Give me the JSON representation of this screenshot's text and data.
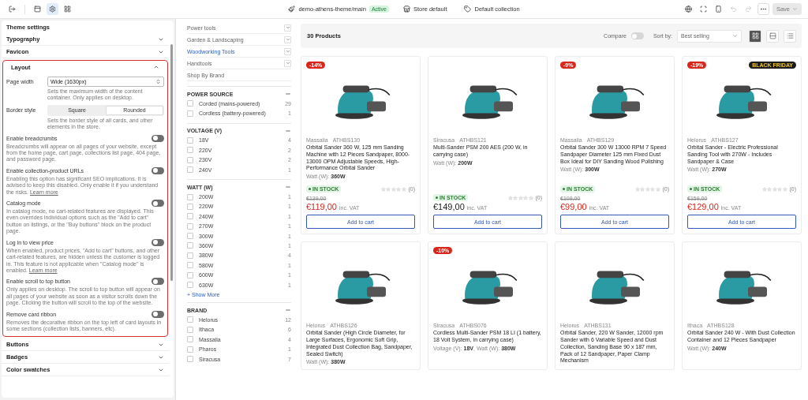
{
  "topbar": {
    "panels": [
      {
        "kind": "sections",
        "selected": false
      },
      {
        "kind": "settings",
        "selected": true
      },
      {
        "kind": "blocks",
        "selected": false
      }
    ],
    "theme": "demo-athens-theme/main",
    "theme_badge": "Active",
    "store": "Store default",
    "collection": "Default collection",
    "undo": {
      "disabled": true
    },
    "redo": {
      "disabled": true
    },
    "save": {
      "label": "Save",
      "disabled": true
    }
  },
  "settings": {
    "title": "Theme settings",
    "sections": [
      {
        "label": "Typography",
        "expanded": false
      },
      {
        "label": "Favicon",
        "expanded": false
      },
      {
        "label": "Layout",
        "expanded": true,
        "content": {
          "page_width": {
            "label": "Page width",
            "value": "Wide (1630px)",
            "help": "Sets the maximum width of the content container. Only applies on desktop."
          },
          "border_style": {
            "label": "Border style",
            "options": [
              {
                "label": "Square",
                "selected": false
              },
              {
                "label": "Rounded",
                "selected": true
              }
            ],
            "help": "Sets the border style of all cards, and other elements in the store."
          },
          "toggles": [
            {
              "label": "Enable breadcrumbs",
              "on": false,
              "help": "Breadcrumbs will appear on all pages of your website, except from the home page, cart page, collections list page, 404 page, and password page."
            },
            {
              "label": "Enable collection-product URLs",
              "on": false,
              "help": "Enabling this option has significant SEO implications. It is advised to keep this disabled. Only enable it if you understand the risks.",
              "link": "Learn more"
            },
            {
              "label": "Catalog mode",
              "on": false,
              "help": "In catalog mode, no cart-related features are displayed. This even overrides individual options such as the \"Add to cart\" button on listings, or the \"Buy buttons\" block on the product page."
            },
            {
              "label": "Log in to view price",
              "on": false,
              "help": "When enabled, product prices, \"Add to cart\" buttons, and other cart-related features, are hidden unless the customer is logged in. This feature is not applicable when \"Catalog mode\" is enabled.",
              "link": "Learn more"
            },
            {
              "label": "Enable scroll to top button",
              "on": false,
              "help": "Only applies on desktop. The scroll to top button will appear on all pages of your website as soon as a visitor scrolls down the page. Clicking the button will scroll to the top of the website."
            },
            {
              "label": "Remove card ribbon",
              "on": false,
              "help": "Removes the decorative ribbon on the top left of card layouts in some sections (collection lists, banners, etc)."
            }
          ]
        }
      },
      {
        "label": "Buttons",
        "expanded": false
      },
      {
        "label": "Badges",
        "expanded": false
      },
      {
        "label": "Color swatches",
        "expanded": false
      }
    ]
  },
  "categories": [
    {
      "label": "Power tools",
      "selected": false,
      "expandable": true
    },
    {
      "label": "Garden & Landscaping",
      "selected": false,
      "expandable": true
    },
    {
      "label": "Woodworking Tools",
      "selected": true,
      "expandable": true
    },
    {
      "label": "Handtools",
      "selected": false,
      "expandable": true
    },
    {
      "label": "Shop By Brand",
      "selected": false,
      "expandable": false
    }
  ],
  "filters": [
    {
      "title": "POWER SOURCE",
      "expanded": true,
      "options": [
        {
          "label": "Corded (mains-powered)",
          "count": "29",
          "checked": false
        },
        {
          "label": "Cordless (battery-powered)",
          "count": "1",
          "checked": false
        }
      ]
    },
    {
      "title": "VOLTAGE (V)",
      "expanded": true,
      "options": [
        {
          "label": "18V",
          "count": "4",
          "checked": false
        },
        {
          "label": "220V",
          "count": "2",
          "checked": false
        },
        {
          "label": "230V",
          "count": "2",
          "checked": false
        },
        {
          "label": "240V",
          "count": "1",
          "checked": false
        }
      ]
    },
    {
      "title": "WATT (W)",
      "expanded": true,
      "options": [
        {
          "label": "200W",
          "count": "1",
          "checked": false
        },
        {
          "label": "220W",
          "count": "1",
          "checked": false
        },
        {
          "label": "240W",
          "count": "1",
          "checked": false
        },
        {
          "label": "270W",
          "count": "1",
          "checked": false
        },
        {
          "label": "300W",
          "count": "1",
          "checked": false
        },
        {
          "label": "360W",
          "count": "1",
          "checked": false
        },
        {
          "label": "380W",
          "count": "4",
          "checked": false
        },
        {
          "label": "580W",
          "count": "1",
          "checked": false
        },
        {
          "label": "600W",
          "count": "1",
          "checked": false
        },
        {
          "label": "630W",
          "count": "1",
          "checked": false
        }
      ],
      "more": "+ Show More"
    },
    {
      "title": "BRAND",
      "expanded": true,
      "options": [
        {
          "label": "Helorus",
          "count": "12",
          "checked": false
        },
        {
          "label": "Ithaca",
          "count": "6",
          "checked": false
        },
        {
          "label": "Massalia",
          "count": "4",
          "checked": false
        },
        {
          "label": "Pharos",
          "count": "1",
          "checked": false
        },
        {
          "label": "Siracusa",
          "count": "7",
          "checked": false
        }
      ]
    }
  ],
  "listing": {
    "count": "30 Products",
    "compare": {
      "label": "Compare",
      "on": false
    },
    "sort_label": "Sort by:",
    "sort_value": "Best selling",
    "views": [
      {
        "kind": "grid",
        "selected": true
      },
      {
        "kind": "rows",
        "selected": false
      },
      {
        "kind": "list",
        "selected": false
      }
    ]
  },
  "products": [
    {
      "badge": "-14%",
      "brand": "Massalia",
      "sku": "ATHBS130",
      "title": "Orbital Sander 360 W, 125 mm Sanding Machine with 12 Pieces Sandpaper, 8000-13000 OPM Adjustable Speeds, High-Performance Orbital Sander",
      "specs": "Watt (W): **360W**",
      "stock": "IN STOCK",
      "stars": 0,
      "reviews": "(0)",
      "old_price": "€139,00",
      "price": "€119,00",
      "sale": true,
      "vat": "inc. VAT",
      "button": "Add to cart"
    },
    {
      "brand": "Siracusa",
      "sku": "ATHBS121",
      "title": "Multi-Sander PSM 200 AES (200 W, in carrying case)",
      "specs": "Watt (W): **200W**",
      "stock": "IN STOCK",
      "stars": 0,
      "reviews": "(0)",
      "price": "€149,00",
      "sale": false,
      "vat": "inc. VAT",
      "button": "Add to cart"
    },
    {
      "badge": "-9%",
      "brand": "Massalia",
      "sku": "ATHBS129",
      "title": "Orbital Sander 300 W 13000 RPM 7 Speed Sandpaper Diameter 125 mm Fixed Dust Box Ideal for DIY Sanding Wood Polishing",
      "specs": "Watt (W): **300W**",
      "stock": "IN STOCK",
      "stars": 0,
      "reviews": "(0)",
      "old_price": "€109,00",
      "price": "€99,00",
      "sale": true,
      "vat": "inc. VAT",
      "button": "Add to cart"
    },
    {
      "badge": "-19%",
      "ribbon": "BLACK FRIDAY",
      "brand": "Helorus",
      "sku": "ATHBS127",
      "title": "Orbital Sander - Electric Professional Sanding Tool with 270W - Includes Sandpaper & Case",
      "specs": "Watt (W): **270W**",
      "stock": "IN STOCK",
      "stars": 0,
      "reviews": "(0)",
      "old_price": "€159,00",
      "price": "€129,00",
      "sale": true,
      "vat": "inc. VAT",
      "button": "Add to cart"
    },
    {
      "brand": "Helorus",
      "sku": "ATHBS126",
      "title": "Orbital Sander (High Circle Diameter, for Large Surfaces, Ergonomic Soft Grip, Integrated Dust Collection Bag, Sandpaper, Sealed Switch)",
      "specs": "Watt (W): **380W**"
    },
    {
      "badge": "-10%",
      "brand": "Siracusa",
      "sku": "ATHBS076",
      "title": "Cordless Multi-Sander PSM 18 LI (1 battery, 18 Volt System, in carrying case)",
      "specs": "Voltage (V): **18V**, Watt (W): **380W**"
    },
    {
      "brand": "Helorus",
      "sku": "ATHBS131",
      "title": "Orbital Sander, 220 W Sander, 12000 rpm Sander with 6 Variable Speed and Dust Collection, Sanding Base 90 x 187 mm, Pack of 12 Sandpaper, Paper Clamp Mechanism"
    },
    {
      "brand": "Ithaca",
      "sku": "ATHBS128",
      "title": "Orbital Sander 240 W - With Dust Collection Container and 12 Pieces Sandpaper",
      "specs": "Watt (W): **240W**"
    }
  ]
}
